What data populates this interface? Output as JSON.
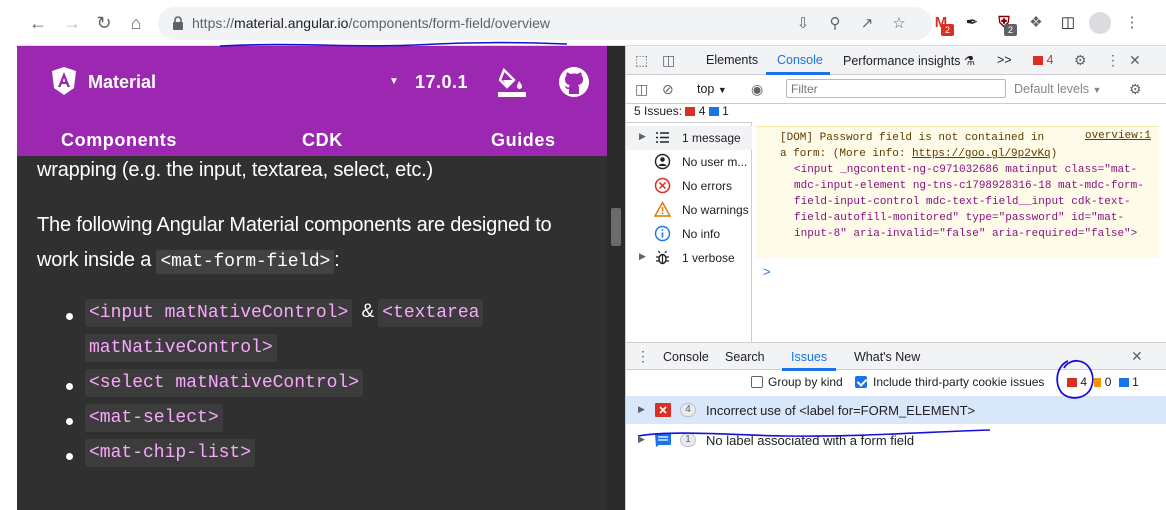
{
  "browser": {
    "url_scheme": "https://",
    "url_host": "material.angular.io",
    "url_path": "/components/form-field/overview",
    "gmail_badge": "2",
    "ext_badge": "2"
  },
  "site": {
    "brand": "Material",
    "version": "17.0.1",
    "nav": [
      "Components",
      "CDK",
      "Guides"
    ],
    "para1": "wrapping (e.g. the input, textarea, select, etc.)",
    "para2_a": "The following Angular Material components are designed to",
    "para2_b": "work inside a",
    "para2_code": "<mat-form-field>",
    "para2_end": ":",
    "bullets": {
      "b1_code1": "<input matNativeControl>",
      "b1_amp": "&",
      "b1_code2": "<textarea",
      "b1_code3": "matNativeControl>",
      "b2": "<select matNativeControl>",
      "b3": "<mat-select>",
      "b4": "<mat-chip-list>"
    }
  },
  "devtools": {
    "tabs": [
      "Elements",
      "Console",
      "Performance insights"
    ],
    "more_tabs": ">>",
    "error_count": "4",
    "context": "top",
    "filter_placeholder": "Filter",
    "levels": "Default levels",
    "issues_label": "5 Issues:",
    "issues_errors": "4",
    "issues_info": "1",
    "sidebar": [
      {
        "label": "1 message"
      },
      {
        "label": "No user m..."
      },
      {
        "label": "No errors"
      },
      {
        "label": "No warnings"
      },
      {
        "label": "No info"
      },
      {
        "label": "1 verbose"
      }
    ],
    "message": {
      "line1": "[DOM] Password field is not contained in",
      "line_ref": "overview:1",
      "line2": "a form: (More info: ",
      "link": "https://goo.gl/9p2vKq",
      "line2_end": ")",
      "html": "<input _ngcontent-ng-c971032686 matinput class=\"mat-mdc-input-element ng-tns-c1798928316-18 mat-mdc-form-field-input-control mdc-text-field__input cdk-text-field-autofill-monitored\" type=\"password\" id=\"mat-input-8\" aria-invalid=\"false\" aria-required=\"false\">"
    },
    "prompt": ">",
    "drawer_tabs": [
      "Console",
      "Search",
      "Issues",
      "What's New"
    ],
    "group_by_kind": "Group by kind",
    "include_third_party": "Include third-party cookie issues",
    "count_red": "4",
    "count_orange": "0",
    "count_blue": "1",
    "issues": [
      {
        "count": "4",
        "title": "Incorrect use of <label for=FORM_ELEMENT>"
      },
      {
        "count": "1",
        "title": "No label associated with a form field"
      }
    ]
  },
  "colors": {
    "accent": "#9c27b0",
    "devtools_blue": "#1a73e8",
    "annotation_ink": "#1a0fd6"
  }
}
